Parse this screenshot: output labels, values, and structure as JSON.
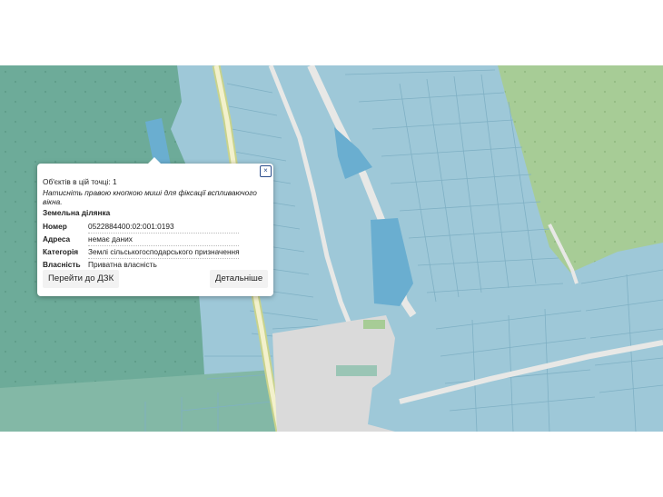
{
  "popup": {
    "objects_count_label": "Об'єктів в цій точці: 1",
    "hint": "Натисніть правою кнопкою миші для фіксації вспливаючого вікна.",
    "close_label": "×",
    "section_title": "Земельна ділянка",
    "fields": [
      {
        "key": "Номер",
        "value": "0522884400:02:001:0193"
      },
      {
        "key": "Адреса",
        "value": "немає даних"
      },
      {
        "key": "Категорія",
        "value": "Землі сільськогосподарського призначення"
      },
      {
        "key": "Власність",
        "value": "Приватна власність"
      }
    ],
    "goto_button": "Перейти до ДЗК",
    "details_button": "Детальніше"
  },
  "colors": {
    "forest": "#6dab99",
    "parcel": "#9ec8d8",
    "parcel_highlight": "#6aaed0",
    "meadow": "#a7cc96",
    "built_up": "#dadada",
    "road": "#e8e8e6",
    "main_road_fill": "#f3f1cc",
    "main_road_edge": "#c8d38c"
  }
}
